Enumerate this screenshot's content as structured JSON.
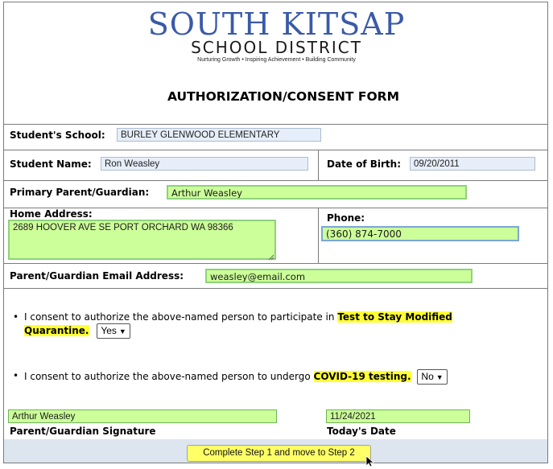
{
  "logo": {
    "main": "SOUTH KITSAP",
    "sub": "SCHOOL DISTRICT",
    "tagline": "Nurturing Growth • Inspiring Achievement • Building Community"
  },
  "form": {
    "title": "AUTHORIZATION/CONSENT FORM",
    "school_label": "Student's School:",
    "school_value": "BURLEY GLENWOOD ELEMENTARY",
    "student_label": "Student Name:",
    "student_value": "Ron Weasley",
    "dob_label": "Date of Birth:",
    "dob_value": "09/20/2011",
    "guardian_label": "Primary Parent/Guardian:",
    "guardian_value": "Arthur Weasley",
    "address_label": "Home Address:",
    "address_value": "2689 HOOVER AVE SE PORT ORCHARD WA 98366",
    "phone_label": "Phone:",
    "phone_value": "(360) 874-7000",
    "email_label": "Parent/Guardian Email Address:",
    "email_value": "weasley@email.com"
  },
  "consents": {
    "first_text": "I consent to authorize the above-named person to participate in",
    "first_highlight_a": "Test to Stay Modified",
    "first_highlight_b": "Quarantine.",
    "first_select": "Yes",
    "second_text": "I consent to authorize the above-named person to undergo",
    "second_highlight": "COVID-19 testing.",
    "second_select": "No"
  },
  "signature": {
    "name_value": "Arthur Weasley",
    "name_label": "Parent/Guardian Signature",
    "date_value": "11/24/2021",
    "date_label": "Today's Date"
  },
  "submit_label": "Complete Step 1 and move to Step 2",
  "colors": {
    "logo_blue": "#3a5aa8",
    "field_green": "#ccff99",
    "field_blue": "#e6eef9",
    "highlight_yellow": "#ffff33",
    "button_yellow": "#ffff66"
  }
}
